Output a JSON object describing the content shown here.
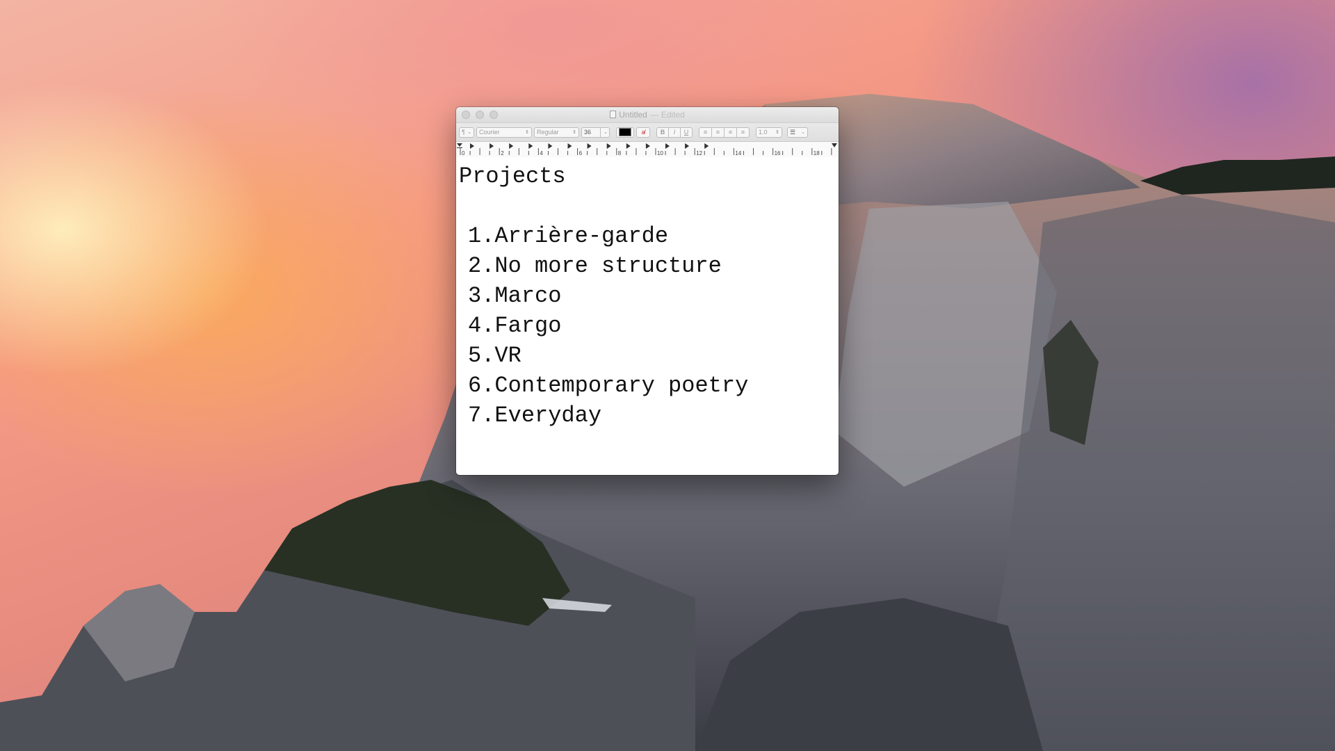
{
  "window": {
    "title": "Untitled",
    "title_separator": "—",
    "status": "Edited"
  },
  "toolbar": {
    "paragraph_style": "¶",
    "font_family": "Courier",
    "font_style": "Regular",
    "font_size": "36",
    "text_color": "#000000",
    "bold_label": "B",
    "italic_label": "I",
    "underline_label": "U",
    "line_spacing": "1.0",
    "list_icon": "list-bullets-icon"
  },
  "ruler": {
    "labels": [
      "0",
      "2",
      "4",
      "6",
      "8",
      "10",
      "12",
      "14",
      "16",
      "18"
    ]
  },
  "document": {
    "heading": "Projects",
    "items": [
      "1.Arrière-garde",
      "2.No more structure",
      "3.Marco",
      "4.Fargo",
      "5.VR",
      "6.Contemporary poetry",
      "7.Everyday"
    ]
  }
}
